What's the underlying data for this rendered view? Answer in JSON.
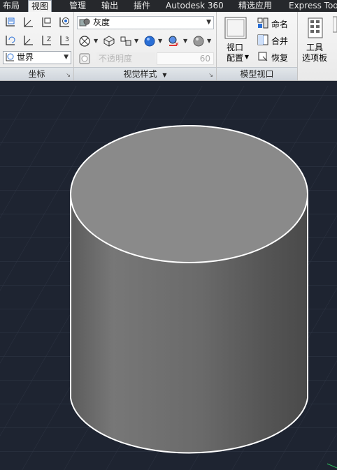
{
  "menu_tabs": [
    {
      "label": "布局",
      "active": false
    },
    {
      "label": "视图",
      "active": true
    },
    {
      "label": "管理",
      "active": false
    },
    {
      "label": "输出",
      "active": false
    },
    {
      "label": "插件",
      "active": false
    },
    {
      "label": "Autodesk 360",
      "active": false
    },
    {
      "label": "精选应用",
      "active": false
    },
    {
      "label": "Express Tools",
      "active": false
    }
  ],
  "panels": {
    "coordinates": {
      "title": "坐标",
      "ucs_combo_value": "世界"
    },
    "visual_styles": {
      "title": "视觉样式",
      "style_combo_value": "灰度",
      "opacity_placeholder": "不透明度",
      "opacity_value": "60"
    },
    "model_viewports": {
      "title": "模型视口",
      "viewport_config_label_line1": "视口",
      "viewport_config_label_line2": "配置",
      "named_label": "命名",
      "join_label": "合并",
      "restore_label": "恢复"
    },
    "tools": {
      "label_line1": "工具",
      "label_line2": "选项板"
    }
  },
  "colors": {
    "viewport_bg": "#1e2431",
    "grid_line": "#323a49",
    "cylinder_top": "#8a8a8a",
    "cylinder_edge": "#ffffff",
    "accent_blue": "#2a6fd6"
  }
}
